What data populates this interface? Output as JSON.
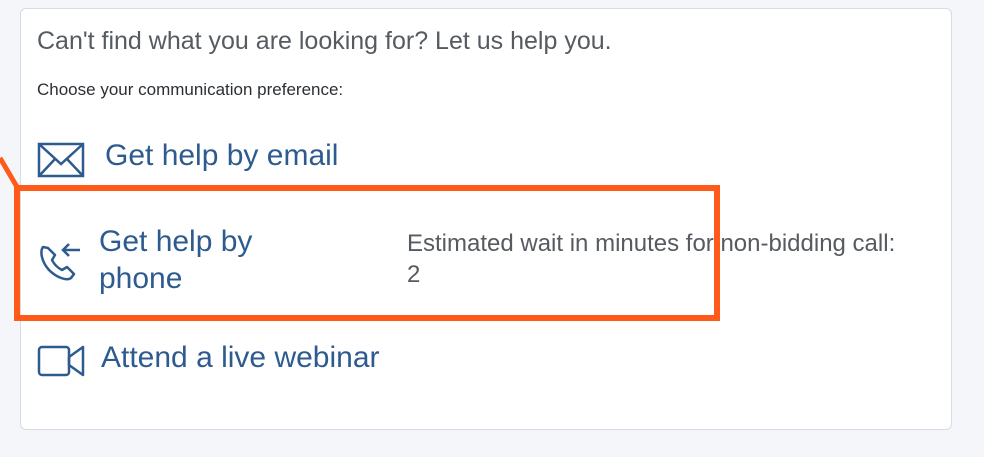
{
  "help_panel": {
    "headline": "Can't find what you are looking for? Let us help you.",
    "subhead": "Choose your communication preference:",
    "options": [
      {
        "label": "Get help by email",
        "icon": "envelope-icon"
      },
      {
        "label": "Get help by phone",
        "icon": "phone-icon",
        "note": "Estimated wait in minutes for non-bidding call: 2"
      },
      {
        "label": "Attend a live webinar",
        "icon": "video-camera-icon"
      }
    ]
  },
  "annotation": {
    "highlight_color": "#ff5a1a"
  },
  "colors": {
    "link": "#2e5b8f",
    "text_muted": "#555b61",
    "card_border": "#d6dce3"
  }
}
